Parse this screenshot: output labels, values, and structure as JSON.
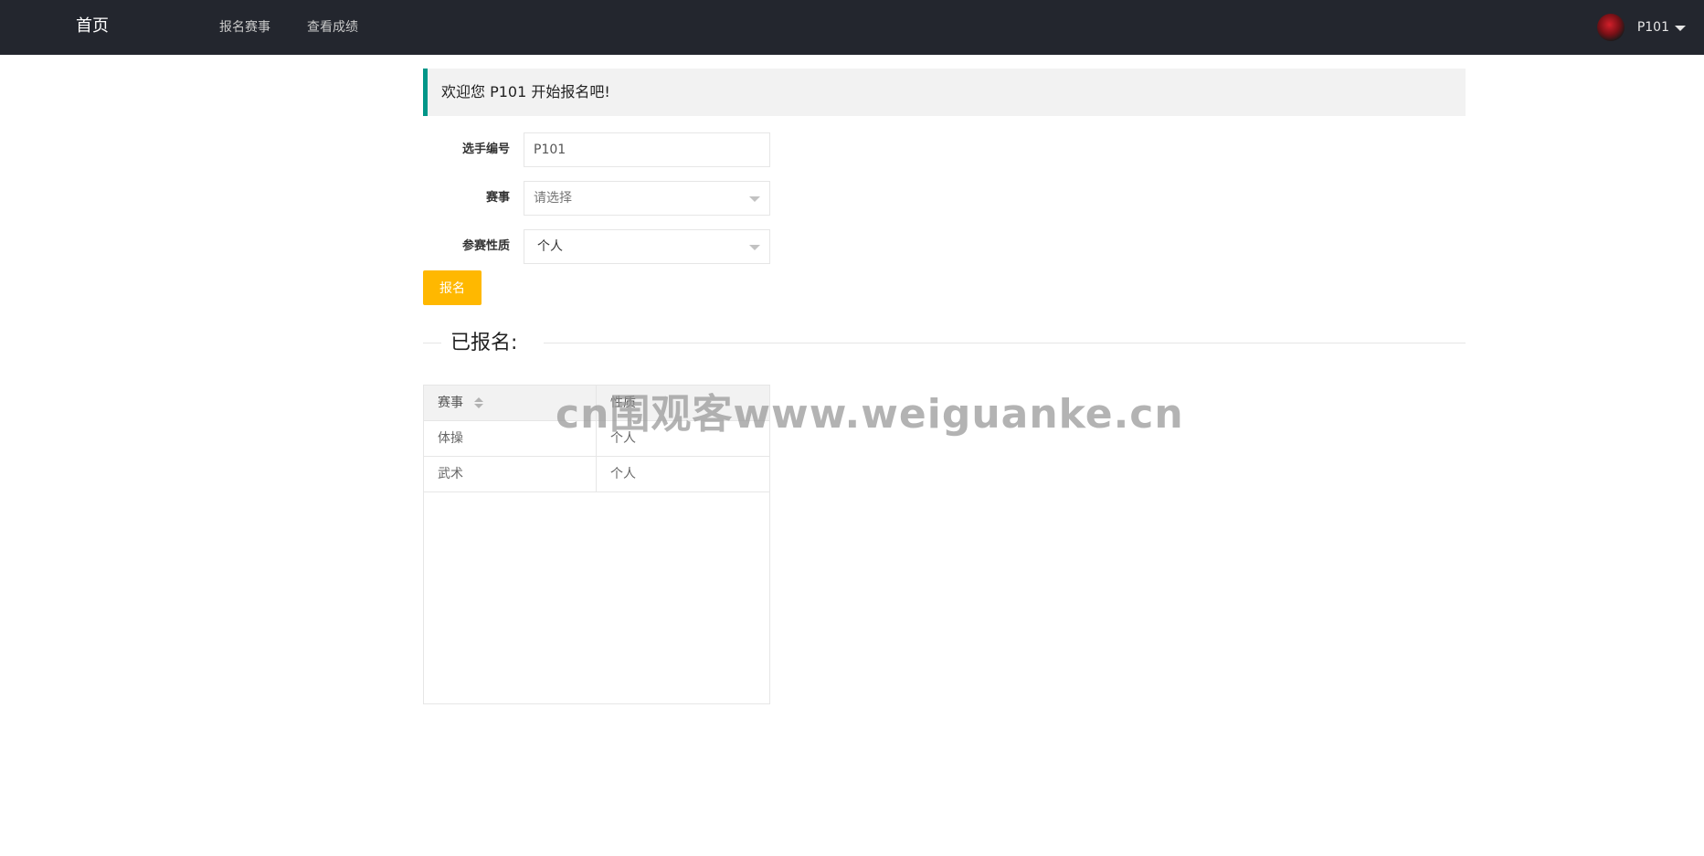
{
  "nav": {
    "brand": "首页",
    "links": [
      {
        "label": "报名赛事"
      },
      {
        "label": "查看成绩"
      }
    ],
    "user": {
      "name": "P101"
    }
  },
  "banner": {
    "text": "欢迎您 P101 开始报名吧!"
  },
  "form": {
    "player_id": {
      "label": "选手编号",
      "value": "P101"
    },
    "event": {
      "label": "赛事",
      "placeholder": "请选择"
    },
    "participation": {
      "label": "参赛性质",
      "value": "个人"
    },
    "submit_label": "报名"
  },
  "registered": {
    "title": "已报名:",
    "columns": [
      "赛事",
      "性质"
    ],
    "rows": [
      [
        "体操",
        "个人"
      ],
      [
        "武术",
        "个人"
      ]
    ]
  },
  "watermark": {
    "text": "cn围观客www.weiguanke.cn"
  },
  "colors": {
    "nav_bg": "#23262e",
    "banner_accent": "#009688",
    "button": "#ffb800"
  }
}
